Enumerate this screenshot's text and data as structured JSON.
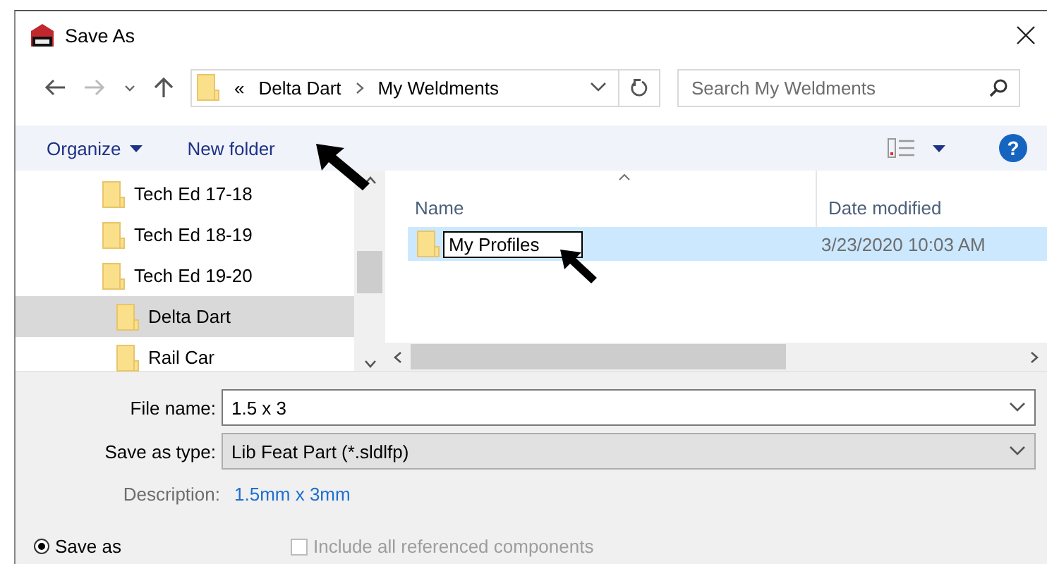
{
  "window": {
    "title": "Save As"
  },
  "address": {
    "overflow": "«",
    "crumbs": [
      "Delta Dart",
      "My Weldments"
    ]
  },
  "search": {
    "placeholder": "Search My Weldments"
  },
  "toolbar": {
    "organize": "Organize",
    "new_folder": "New folder",
    "help": "?"
  },
  "tree": [
    {
      "label": "Tech Ed 17-18",
      "selected": false
    },
    {
      "label": "Tech Ed 18-19",
      "selected": false
    },
    {
      "label": "Tech Ed 19-20",
      "selected": false,
      "children": [
        {
          "label": "Delta Dart",
          "selected": true
        },
        {
          "label": "Rail Car",
          "selected": false
        }
      ]
    }
  ],
  "columns": [
    "Name",
    "Date modified"
  ],
  "files": [
    {
      "name": "My Profiles",
      "date": "3/23/2020 10:03 AM",
      "selected": true,
      "renaming": true
    }
  ],
  "file_name": {
    "label": "File name:",
    "value": "1.5 x 3"
  },
  "save_type": {
    "label": "Save as type:",
    "value": "Lib Feat Part (*.sldlfp)"
  },
  "description": {
    "label": "Description:",
    "value": "1.5mm x 3mm"
  },
  "options": [
    {
      "kind": "radio",
      "label": "Save as",
      "checked": true,
      "disabled": false
    },
    {
      "kind": "checkbox",
      "label": "Include all referenced components",
      "checked": false,
      "disabled": true
    }
  ]
}
